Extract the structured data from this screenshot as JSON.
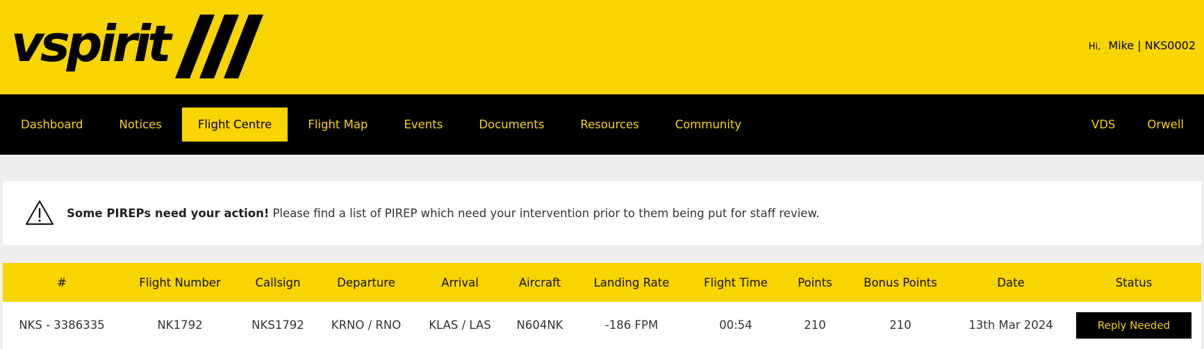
{
  "header": {
    "logo_text": "vspirit",
    "greeting_hi": "Hi,",
    "user": "Mike | NKS0002"
  },
  "nav": {
    "left": [
      "Dashboard",
      "Notices",
      "Flight Centre",
      "Flight Map",
      "Events",
      "Documents",
      "Resources",
      "Community"
    ],
    "right": [
      "VDS",
      "Orwell"
    ],
    "active": "Flight Centre"
  },
  "alert": {
    "icon": "warning-triangle-icon",
    "bold": "Some PIREPs need your action!",
    "text": "Please find a list of PIREP which need your intervention prior to them being put for staff review."
  },
  "table": {
    "headers": [
      "#",
      "Flight Number",
      "Callsign",
      "Departure",
      "Arrival",
      "Aircraft",
      "Landing Rate",
      "Flight Time",
      "Points",
      "Bonus Points",
      "Date",
      "Status"
    ],
    "rows": [
      [
        "NKS - 3386335",
        "NK1792",
        "NKS1792",
        "KRNO / RNO",
        "KLAS / LAS",
        "N604NK",
        "-186 FPM",
        "00:54",
        "210",
        "210",
        "13th Mar 2024",
        "Reply Needed"
      ]
    ]
  },
  "colors": {
    "brand_yellow": "#f8d400",
    "nav_black": "#000000"
  }
}
